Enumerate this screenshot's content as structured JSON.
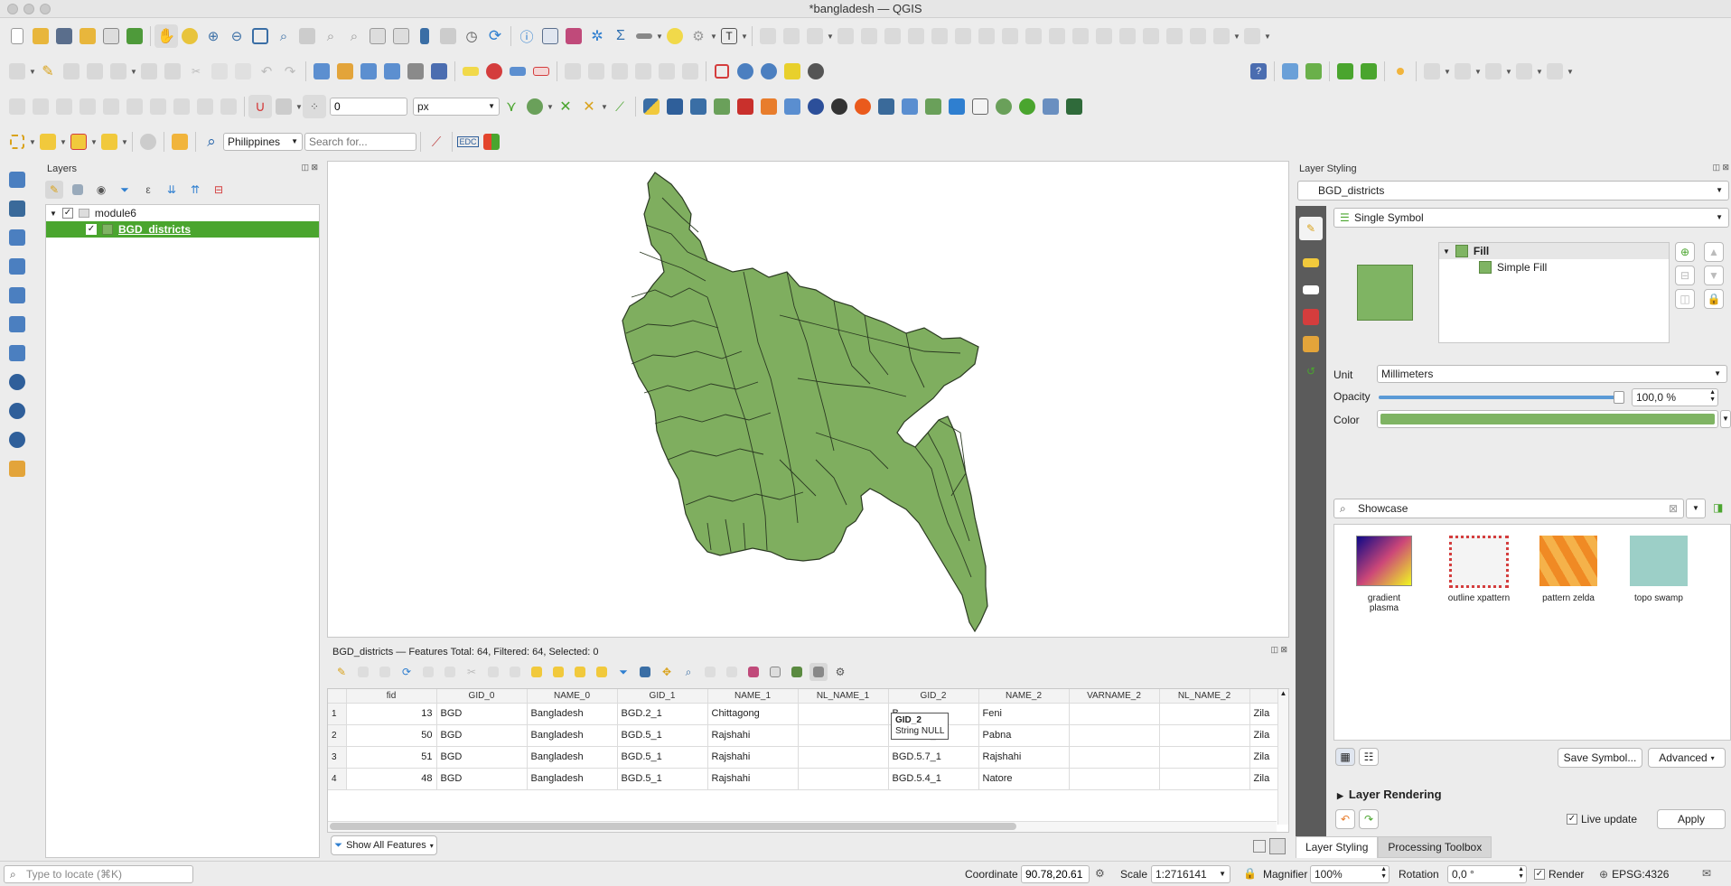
{
  "window": {
    "title": "*bangladesh — QGIS"
  },
  "toolbar": {
    "snap_tolerance": "0",
    "snap_unit": "px",
    "locator_scope": "Philippines",
    "search_placeholder": "Search for...",
    "edc_label": "EDC"
  },
  "layers_panel": {
    "title": "Layers",
    "group_name": "module6",
    "layer_name": "BGD_districts"
  },
  "attribute_table": {
    "summary": "BGD_districts — Features Total: 64, Filtered: 64, Selected: 0",
    "columns": [
      "fid",
      "GID_0",
      "NAME_0",
      "GID_1",
      "NAME_1",
      "NL_NAME_1",
      "GID_2",
      "NAME_2",
      "VARNAME_2",
      "NL_NAME_2"
    ],
    "rows": [
      {
        "n": "1",
        "fid": "13",
        "gid0": "BGD",
        "name0": "Bangladesh",
        "gid1": "BGD.2_1",
        "name1": "Chittagong",
        "nl1": "",
        "gid2": "B",
        "name2": "Feni",
        "var2": "",
        "nl2": "",
        "extra": "Zila"
      },
      {
        "n": "2",
        "fid": "50",
        "gid0": "BGD",
        "name0": "Bangladesh",
        "gid1": "BGD.5_1",
        "name1": "Rajshahi",
        "nl1": "",
        "gid2": "BGD.5.6_1",
        "name2": "Pabna",
        "var2": "",
        "nl2": "",
        "extra": "Zila"
      },
      {
        "n": "3",
        "fid": "51",
        "gid0": "BGD",
        "name0": "Bangladesh",
        "gid1": "BGD.5_1",
        "name1": "Rajshahi",
        "nl1": "",
        "gid2": "BGD.5.7_1",
        "name2": "Rajshahi",
        "var2": "",
        "nl2": "",
        "extra": "Zila"
      },
      {
        "n": "4",
        "fid": "48",
        "gid0": "BGD",
        "name0": "Bangladesh",
        "gid1": "BGD.5_1",
        "name1": "Rajshahi",
        "nl1": "",
        "gid2": "BGD.5.4_1",
        "name2": "Natore",
        "var2": "",
        "nl2": "",
        "extra": "Zila"
      }
    ],
    "tooltip_title": "GID_2",
    "tooltip_type": "String NULL",
    "show_all_label": "Show All Features"
  },
  "styling": {
    "title": "Layer Styling",
    "layer": "BGD_districts",
    "renderer": "Single Symbol",
    "tree_fill": "Fill",
    "tree_simple_fill": "Simple Fill",
    "unit_label": "Unit",
    "unit_value": "Millimeters",
    "opacity_label": "Opacity",
    "opacity_value": "100,0 %",
    "opacity_fraction": 1.0,
    "color_label": "Color",
    "fill_color": "#7fb463",
    "search_value": "Showcase",
    "swatches": [
      {
        "label": "gradient  plasma"
      },
      {
        "label": "outline xpattern"
      },
      {
        "label": "pattern zelda"
      },
      {
        "label": "topo swamp"
      }
    ],
    "save_symbol": "Save Symbol...",
    "advanced": "Advanced",
    "layer_rendering": "Layer Rendering",
    "live_update": "Live update",
    "apply": "Apply"
  },
  "dock_tabs": [
    "Layer Styling",
    "Processing Toolbox"
  ],
  "statusbar": {
    "locate_placeholder": "Type to locate (⌘K)",
    "coordinate_label": "Coordinate",
    "coordinate_value": "90.78,20.61",
    "scale_label": "Scale",
    "scale_value": "1:2716141",
    "magnifier_label": "Magnifier",
    "magnifier_value": "100%",
    "rotation_label": "Rotation",
    "rotation_value": "0,0 °",
    "render_label": "Render",
    "crs": "EPSG:4326"
  },
  "colors": {
    "accent_green": "#4aa52e",
    "map_fill": "#7fae5f"
  }
}
